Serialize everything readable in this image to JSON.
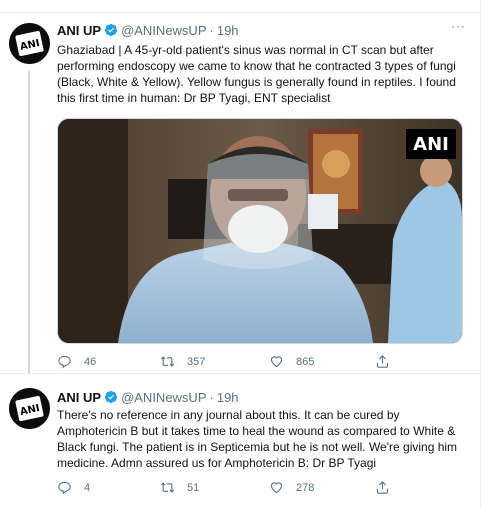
{
  "tweets": [
    {
      "author": "ANI UP",
      "handle": "@ANINewsUP",
      "separator": "·",
      "time": "19h",
      "more": "···",
      "text": "Ghaziabad | A 45-yr-old patient's sinus was normal in CT scan but after performing endoscopy we came to know that he contracted 3 types of fungi (Black, White & Yellow). Yellow fungus is generally found in reptiles. I found this first time in human: Dr BP Tyagi, ENT specialist",
      "media_watermark": "ANI",
      "replies": "46",
      "retweets": "357",
      "likes": "865"
    },
    {
      "author": "ANI UP",
      "handle": "@ANINewsUP",
      "separator": "·",
      "time": "19h",
      "text": "There's no reference in any journal about this. It can be cured by Amphotericin B but it takes time to heal the wound as compared to White & Black fungi. The patient is in Septicemia but he is not well. We're giving him medicine. Admn assured us for Amphotericin B: Dr BP Tyagi",
      "replies": "4",
      "retweets": "51",
      "likes": "278"
    }
  ],
  "colors": {
    "verified": "#1da1f2",
    "muted_text": "#5b7083",
    "divider": "#ebeef0",
    "text": "#0f1419"
  },
  "icons": [
    "ani-logo-avatar",
    "verified-badge-icon",
    "more-icon",
    "reply-icon",
    "retweet-icon",
    "like-icon",
    "share-icon"
  ]
}
